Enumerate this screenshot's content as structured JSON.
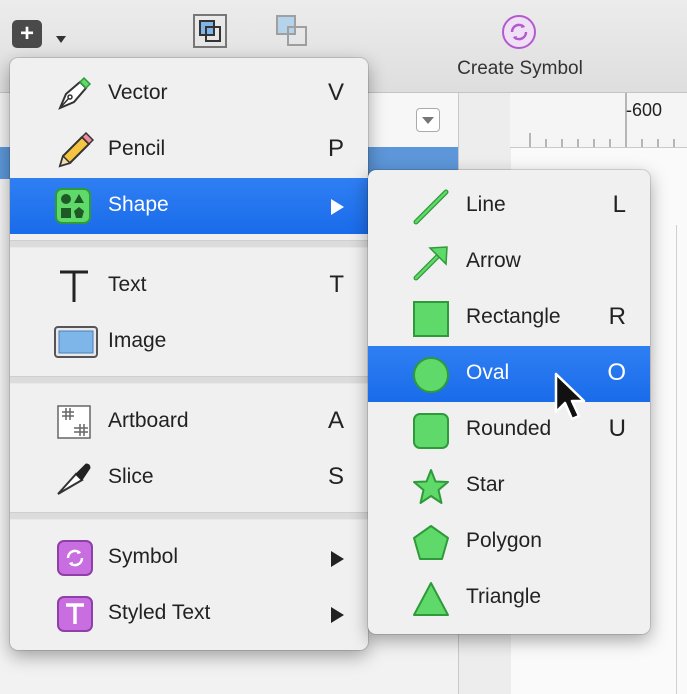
{
  "toolbar": {
    "insert_button": "+",
    "create_symbol_label": "Create Symbol"
  },
  "ruler": {
    "label": "-600"
  },
  "insert_menu": {
    "items": [
      {
        "label": "Vector",
        "shortcut": "V",
        "icon": "pen-icon"
      },
      {
        "label": "Pencil",
        "shortcut": "P",
        "icon": "pencil-icon"
      },
      {
        "label": "Shape",
        "shortcut": "",
        "icon": "shapes-icon",
        "submenu": true,
        "highlighted": true
      },
      {
        "label": "Text",
        "shortcut": "T",
        "icon": "text-icon"
      },
      {
        "label": "Image",
        "shortcut": "",
        "icon": "image-icon"
      },
      {
        "label": "Artboard",
        "shortcut": "A",
        "icon": "artboard-icon"
      },
      {
        "label": "Slice",
        "shortcut": "S",
        "icon": "slice-knife-icon"
      },
      {
        "label": "Symbol",
        "shortcut": "",
        "icon": "symbol-icon",
        "submenu": true
      },
      {
        "label": "Styled Text",
        "shortcut": "",
        "icon": "styled-text-icon",
        "submenu": true
      }
    ]
  },
  "shape_submenu": {
    "items": [
      {
        "label": "Line",
        "shortcut": "L",
        "icon": "line-icon"
      },
      {
        "label": "Arrow",
        "shortcut": "",
        "icon": "arrow-icon"
      },
      {
        "label": "Rectangle",
        "shortcut": "R",
        "icon": "rectangle-icon"
      },
      {
        "label": "Oval",
        "shortcut": "O",
        "icon": "oval-icon",
        "highlighted": true
      },
      {
        "label": "Rounded",
        "shortcut": "U",
        "icon": "rounded-rectangle-icon"
      },
      {
        "label": "Star",
        "shortcut": "",
        "icon": "star-icon"
      },
      {
        "label": "Polygon",
        "shortcut": "",
        "icon": "polygon-icon"
      },
      {
        "label": "Triangle",
        "shortcut": "",
        "icon": "triangle-icon"
      }
    ]
  },
  "colors": {
    "highlight": "#1f72ee",
    "shape_green": "#5fd96a",
    "shape_green_stroke": "#2f9a3a",
    "symbol_purple": "#c86ee0"
  }
}
